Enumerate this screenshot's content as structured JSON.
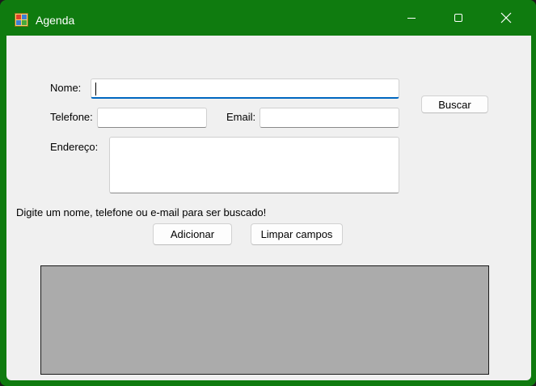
{
  "window": {
    "title": "Agenda",
    "icon": "form-app-icon",
    "accent": "#0f7b0f"
  },
  "form": {
    "nome_label": "Nome:",
    "nome_value": "",
    "telefone_label": "Telefone:",
    "telefone_value": "",
    "email_label": "Email:",
    "email_value": "",
    "endereco_label": "Endereço:",
    "endereco_value": "",
    "hint": "Digite um nome, telefone ou e-mail para ser buscado!"
  },
  "buttons": {
    "buscar": "Buscar",
    "adicionar": "Adicionar",
    "limpar": "Limpar campos"
  },
  "grid": {
    "background": "#ababab"
  }
}
